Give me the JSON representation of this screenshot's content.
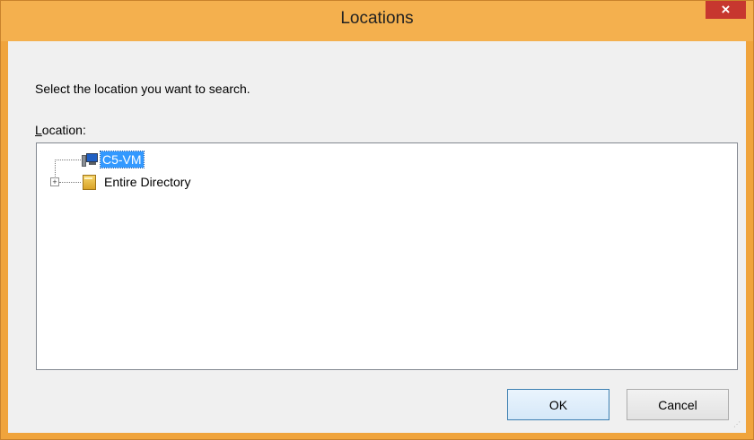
{
  "window": {
    "title": "Locations",
    "close_glyph": "×",
    "accent_color": "#f4b04e",
    "close_color": "#c7372f"
  },
  "dialog": {
    "prompt": "Select the location you want to search.",
    "location_label_access_key": "L",
    "location_label_rest": "ocation:"
  },
  "tree": {
    "items": [
      {
        "label": "C5-VM",
        "icon": "computer-icon",
        "selected": true
      },
      {
        "label": "Entire Directory",
        "icon": "directory-icon",
        "expander": "+"
      }
    ]
  },
  "buttons": {
    "ok_label": "OK",
    "cancel_label": "Cancel"
  },
  "grip_glyph": "⋰"
}
